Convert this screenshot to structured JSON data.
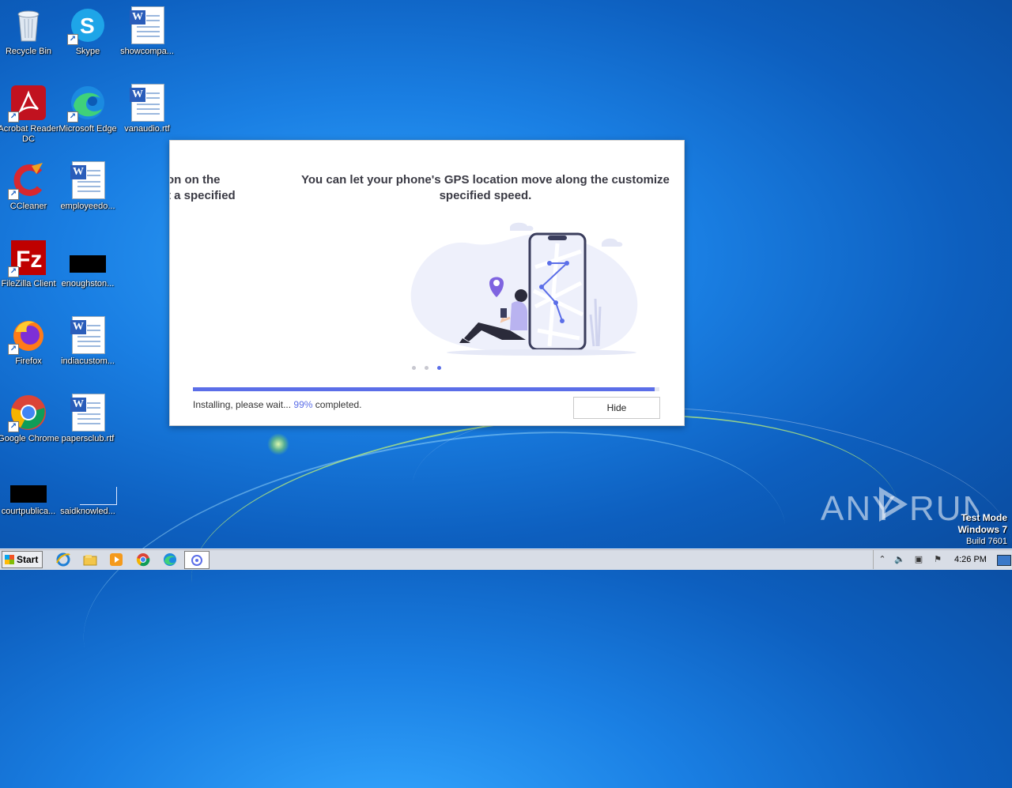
{
  "desktop_icons": [
    {
      "label": "Recycle Bin",
      "icon": "recycle-bin-icon"
    },
    {
      "label": "Skype",
      "icon": "skype-icon"
    },
    {
      "label": "showcompa...",
      "icon": "word-document-icon"
    },
    {
      "label": "Acrobat Reader DC",
      "icon": "acrobat-icon"
    },
    {
      "label": "Microsoft Edge",
      "icon": "edge-icon"
    },
    {
      "label": "vanaudio.rtf",
      "icon": "word-document-icon"
    },
    {
      "label": "CCleaner",
      "icon": "ccleaner-icon"
    },
    {
      "label": "employeedo...",
      "icon": "word-document-icon"
    },
    {
      "label": "FileZilla Client",
      "icon": "filezilla-icon"
    },
    {
      "label": "enoughston...",
      "icon": "black-thumbnail-icon"
    },
    {
      "label": "Firefox",
      "icon": "firefox-icon"
    },
    {
      "label": "indiacustom...",
      "icon": "word-document-icon"
    },
    {
      "label": "Google Chrome",
      "icon": "chrome-icon"
    },
    {
      "label": "papersclub.rtf",
      "icon": "word-document-icon"
    },
    {
      "label": "courtpublica...",
      "icon": "black-thumbnail-icon"
    },
    {
      "label": "saidknowled...",
      "icon": "blank-thumbnail-icon"
    }
  ],
  "installer": {
    "prev_slide_text_line1": "on on the",
    "prev_slide_text_line2": "t a specified",
    "slide_text_line1": "You can let your phone's GPS location move along the customize",
    "slide_text_line2": "specified speed.",
    "status_prefix": "Installing, please wait...",
    "percent": "99%",
    "status_suffix": "completed.",
    "progress": 0.99,
    "hide_label": "Hide",
    "slide_count": 3,
    "active_slide": 3,
    "accent_color": "#5b6ee8"
  },
  "watermark": {
    "brand": "ANY RUN",
    "line1": "Test Mode",
    "line2": "Windows 7",
    "line3": "Build 7601"
  },
  "taskbar": {
    "start_label": "Start",
    "clock": "4:26 PM",
    "pinned": [
      "internet-explorer-icon",
      "file-explorer-icon",
      "media-player-icon",
      "chrome-icon",
      "edge-icon",
      "installer-app-icon"
    ]
  }
}
